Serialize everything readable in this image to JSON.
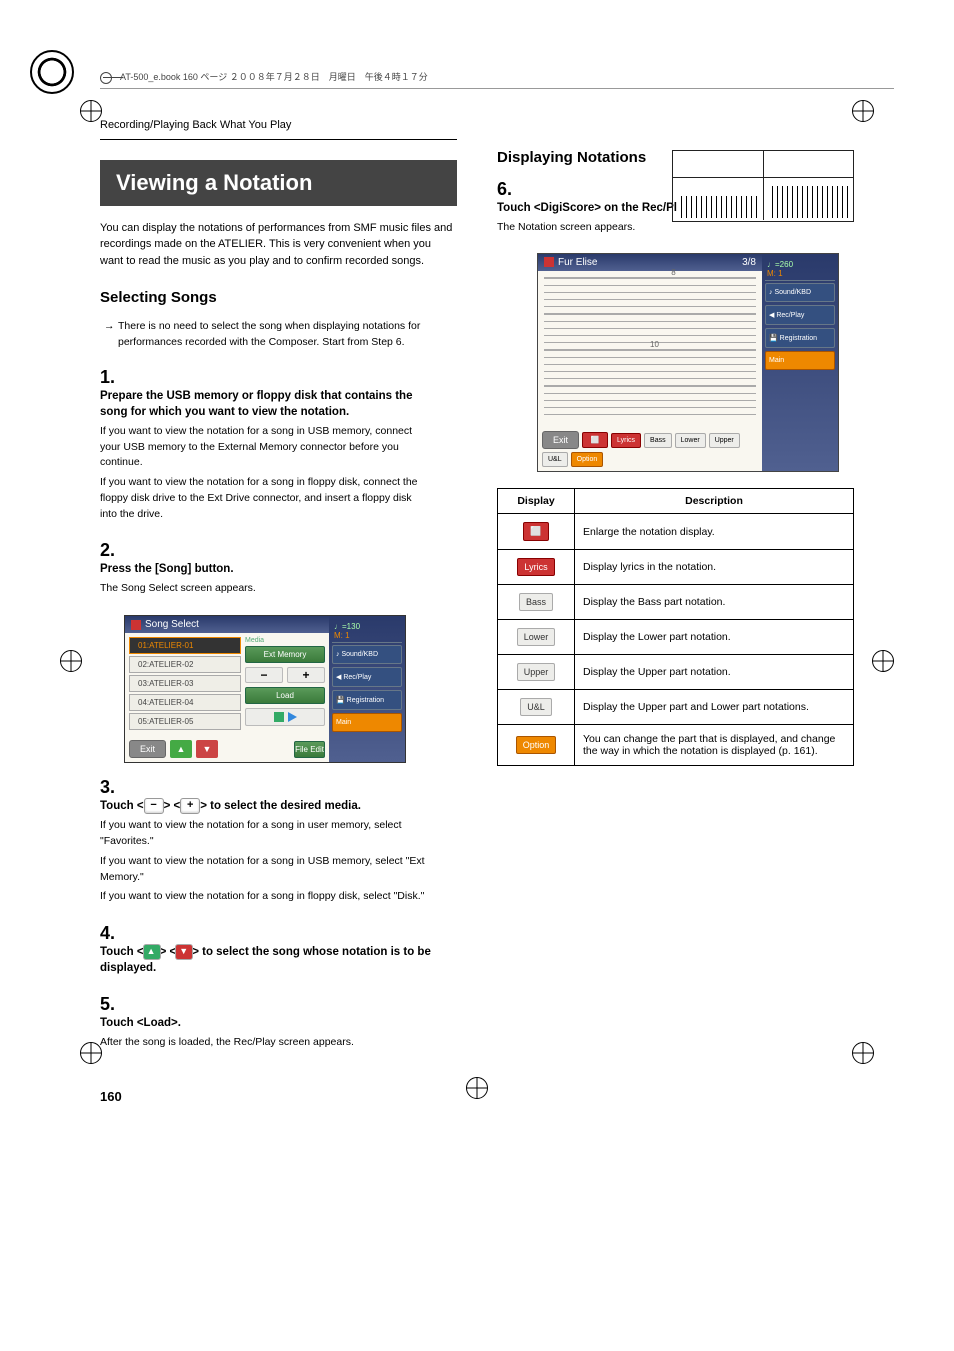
{
  "header_note": "AT-500_e.book  160 ページ  ２００８年７月２８日　月曜日　午後４時１７分",
  "breadcrumb": "Recording/Playing Back What You Play",
  "main_title": "Viewing a Notation",
  "intro": "You can display the notations of performances from SMF music files and recordings made on the ATELIER. This is very convenient when you want to read the music as you play and to confirm recorded songs.",
  "section1": {
    "heading": "Selecting Songs",
    "note": "There is no need to select the song when displaying notations for performances recorded with the Composer. Start from Step 6.",
    "steps": [
      {
        "n": "1.",
        "title": "Prepare the USB memory or floppy disk that contains the song for which you want to view the notation.",
        "p1": "If you want to view the notation for a song in USB memory, connect your USB memory to the External Memory connector before you continue.",
        "p2": "If you want to view the notation for a song in floppy disk, connect the floppy disk drive to the Ext Drive connector, and insert a floppy disk into the drive."
      },
      {
        "n": "2.",
        "title": "Press the [Song] button.",
        "p1": "The Song Select screen appears."
      },
      {
        "n": "3.",
        "title_prefix": "Touch <",
        "title_mid": "> <",
        "title_suffix": "> to select the desired media.",
        "p1": "If you want to view the notation for a song in user memory, select \"Favorites.\"",
        "p2": "If you want to view the notation for a song in USB memory, select \"Ext Memory.\"",
        "p3": "If you want to view the notation for a song in floppy disk, select \"Disk.\""
      },
      {
        "n": "4.",
        "title_prefix": "Touch <",
        "title_mid": "> <",
        "title_suffix": "> to select the song whose notation is to be displayed."
      },
      {
        "n": "5.",
        "title": "Touch <Load>.",
        "p1": "After the song is loaded, the Rec/Play screen appears."
      }
    ]
  },
  "songselect": {
    "title": "Song Select",
    "tempo": "♩=130",
    "measure": "M:    1",
    "media_label": "Media",
    "media_value": "Ext Memory",
    "load": "Load",
    "file_edit": "File Edit",
    "exit": "Exit",
    "items": [
      "01:ATELIER-01",
      "02:ATELIER-02",
      "03:ATELIER-03",
      "04:ATELIER-04",
      "05:ATELIER-05"
    ],
    "side": {
      "sound": "Sound/KBD",
      "rec": "Rec/Play",
      "reg": "Registration",
      "main": "Main"
    }
  },
  "section2": {
    "heading": "Displaying Notations",
    "step6": {
      "n": "6.",
      "title": "Touch <DigiScore> on the Rec/Play screen.",
      "p1": "The Notation screen appears."
    }
  },
  "notation": {
    "title": "Fur Elise",
    "pos": "3/8",
    "tempo": "♩=260",
    "measure": "M:    1",
    "exit": "Exit",
    "buttons": {
      "lyrics": "Lyrics",
      "bass": "Bass",
      "lower": "Lower",
      "upper": "Upper",
      "ul": "U&L",
      "option": "Option"
    },
    "side": {
      "sound": "Sound/KBD",
      "rec": "Rec/Play",
      "reg": "Registration",
      "main": "Main"
    }
  },
  "table": {
    "h_display": "Display",
    "h_desc": "Description",
    "rows": [
      {
        "icon_label": "",
        "desc": "Enlarge the notation display."
      },
      {
        "icon_label": "Lyrics",
        "desc": "Display lyrics in the notation."
      },
      {
        "icon_label": "Bass",
        "desc": "Display the Bass part notation."
      },
      {
        "icon_label": "Lower",
        "desc": "Display the Lower part notation."
      },
      {
        "icon_label": "Upper",
        "desc": "Display the Upper part notation."
      },
      {
        "icon_label": "U&L",
        "desc": "Display the Upper part and Lower part notations."
      },
      {
        "icon_label": "Option",
        "desc": "You can change the part that is displayed, and change the way in which the notation is displayed (p. 161)."
      }
    ]
  },
  "page_number": "160"
}
